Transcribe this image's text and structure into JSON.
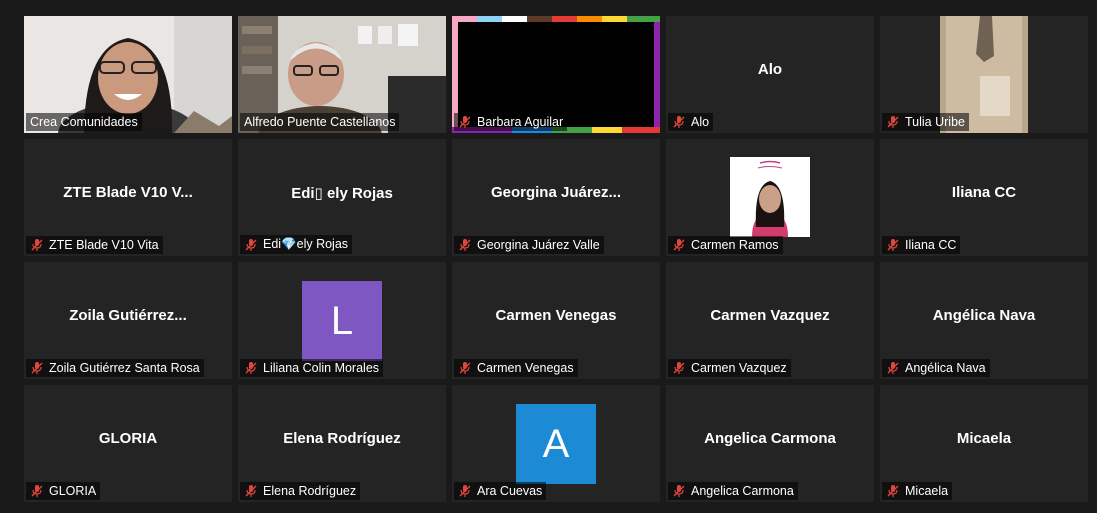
{
  "participants": [
    {
      "label": "Crea Comunidades",
      "display": "",
      "muted": false,
      "type": "video",
      "active": true
    },
    {
      "label": "Alfredo Puente Castellanos",
      "display": "",
      "muted": false,
      "type": "video"
    },
    {
      "label": "Barbara Aguilar",
      "display": "",
      "muted": true,
      "type": "video"
    },
    {
      "label": "Alo",
      "display": "Alo",
      "muted": true,
      "type": "name"
    },
    {
      "label": "Tulia Uribe",
      "display": "",
      "muted": true,
      "type": "video"
    },
    {
      "label": "ZTE Blade V10 Vita",
      "display": "ZTE Blade V10 V...",
      "muted": true,
      "type": "name"
    },
    {
      "label": "Edi💎ely Rojas",
      "display": "Edi▯ ely Rojas",
      "muted": true,
      "type": "name"
    },
    {
      "label": "Georgina Juárez Valle",
      "display": "Georgina  Juárez...",
      "muted": true,
      "type": "name"
    },
    {
      "label": "Carmen Ramos",
      "display": "",
      "muted": true,
      "type": "photo"
    },
    {
      "label": "Iliana CC",
      "display": "Iliana CC",
      "muted": true,
      "type": "name"
    },
    {
      "label": "Zoila Gutiérrez Santa Rosa",
      "display": "Zoila  Gutiérrez...",
      "muted": true,
      "type": "name"
    },
    {
      "label": "Liliana Colin Morales",
      "display": "",
      "avatar_letter": "L",
      "avatar_color": "#7e57c2",
      "muted": true,
      "type": "avatar"
    },
    {
      "label": "Carmen Venegas",
      "display": "Carmen Venegas",
      "muted": true,
      "type": "name"
    },
    {
      "label": "Carmen Vazquez",
      "display": "Carmen Vazquez",
      "muted": true,
      "type": "name"
    },
    {
      "label": "Angélica Nava",
      "display": "Angélica Nava",
      "muted": true,
      "type": "name"
    },
    {
      "label": "GLORIA",
      "display": "GLORIA",
      "muted": true,
      "type": "name"
    },
    {
      "label": "Elena Rodríguez",
      "display": "Elena Rodríguez",
      "muted": true,
      "type": "name"
    },
    {
      "label": "Ara Cuevas",
      "display": "",
      "avatar_letter": "A",
      "avatar_color": "#1d8ad6",
      "muted": true,
      "type": "avatar"
    },
    {
      "label": "Angelica Carmona",
      "display": "Angelica Carmona",
      "muted": true,
      "type": "name"
    },
    {
      "label": "Micaela",
      "display": "Micaela",
      "muted": true,
      "type": "name"
    }
  ],
  "colors": {
    "active_border": "#c9e26a",
    "muted_icon": "#e0463c"
  }
}
